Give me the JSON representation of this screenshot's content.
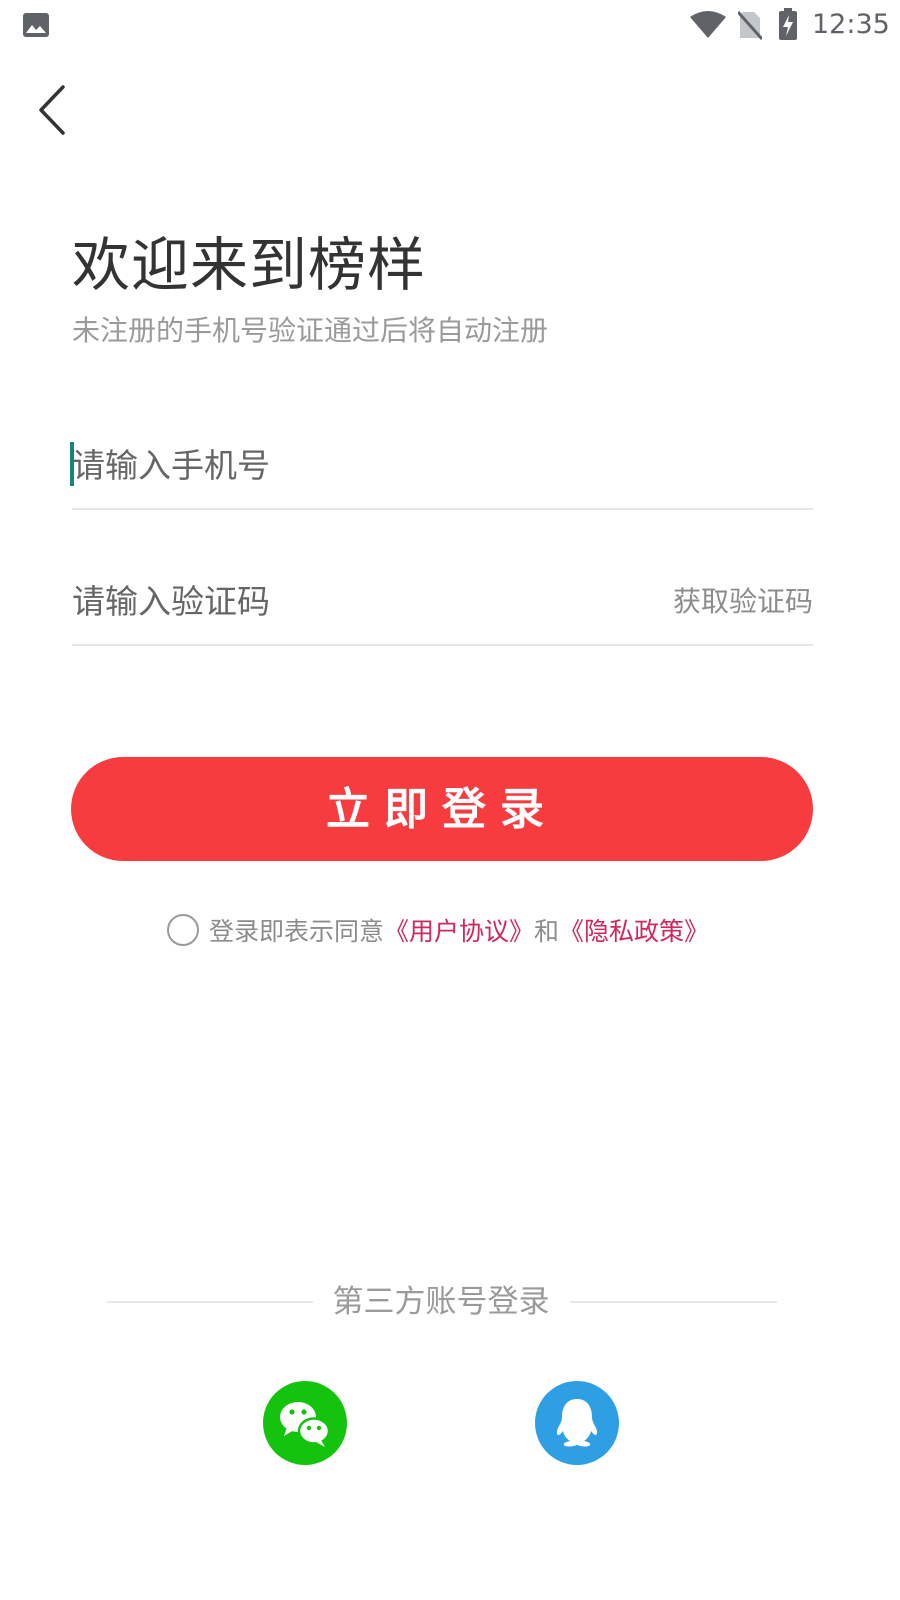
{
  "status_bar": {
    "time": "12:35",
    "icons": [
      "gallery-icon",
      "wifi-icon",
      "no-sim-icon",
      "battery-charging-icon"
    ]
  },
  "header": {
    "back_icon": "chevron-left-icon"
  },
  "welcome": {
    "title": "欢迎来到榜样",
    "subtitle": "未注册的手机号验证通过后将自动注册"
  },
  "form": {
    "phone_placeholder": "请输入手机号",
    "phone_value": "",
    "code_placeholder": "请输入验证码",
    "code_value": "",
    "get_code_label": "获取验证码",
    "login_label": "立即登录"
  },
  "agreement": {
    "checked": false,
    "prefix": "登录即表示同意",
    "user_agreement": "《用户协议》",
    "conjunction": "和",
    "privacy_policy": "《隐私政策》"
  },
  "third_party": {
    "label": "第三方账号登录",
    "providers": [
      {
        "icon": "wechat-icon",
        "color": "#14c30d"
      },
      {
        "icon": "qq-icon",
        "color": "#2f9fe4"
      }
    ]
  },
  "colors": {
    "accent": "#f73c40",
    "link": "#d0285a",
    "cursor": "#14857a"
  }
}
